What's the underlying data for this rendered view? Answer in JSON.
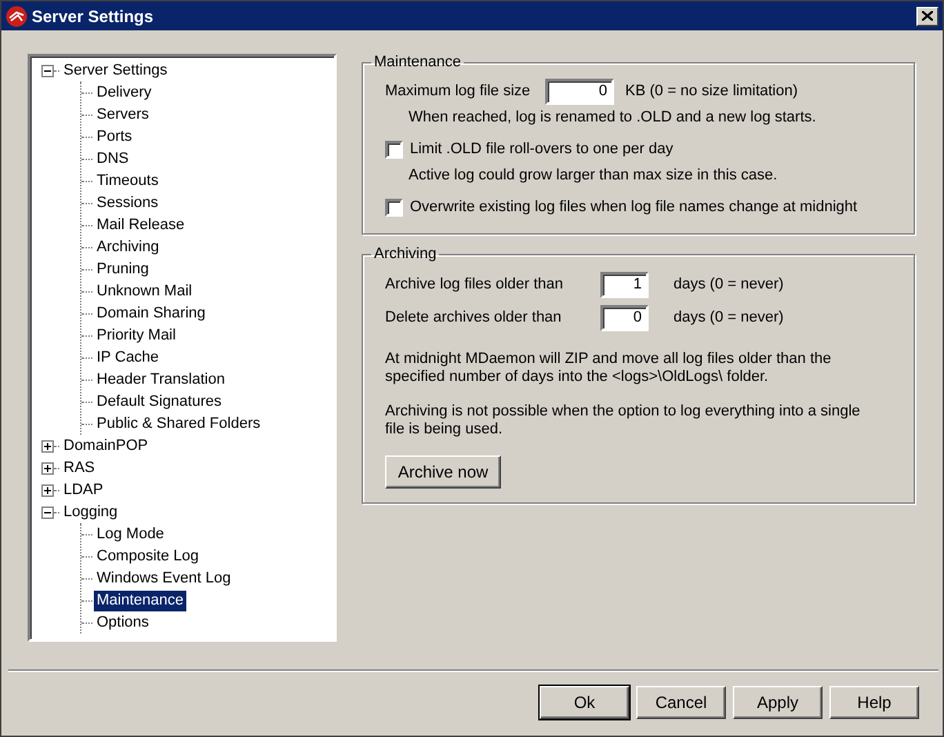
{
  "window": {
    "title": "Server Settings"
  },
  "tree": [
    {
      "label": "Server Settings",
      "expanded": true,
      "selected": false,
      "children": [
        {
          "label": "Delivery",
          "selected": false
        },
        {
          "label": "Servers",
          "selected": false
        },
        {
          "label": "Ports",
          "selected": false
        },
        {
          "label": "DNS",
          "selected": false
        },
        {
          "label": "Timeouts",
          "selected": false
        },
        {
          "label": "Sessions",
          "selected": false
        },
        {
          "label": "Mail Release",
          "selected": false
        },
        {
          "label": "Archiving",
          "selected": false
        },
        {
          "label": "Pruning",
          "selected": false
        },
        {
          "label": "Unknown Mail",
          "selected": false
        },
        {
          "label": "Domain Sharing",
          "selected": false
        },
        {
          "label": "Priority Mail",
          "selected": false
        },
        {
          "label": "IP Cache",
          "selected": false
        },
        {
          "label": "Header Translation",
          "selected": false
        },
        {
          "label": "Default Signatures",
          "selected": false
        },
        {
          "label": "Public & Shared Folders",
          "selected": false
        }
      ]
    },
    {
      "label": "DomainPOP",
      "expanded": false,
      "selected": false
    },
    {
      "label": "RAS",
      "expanded": false,
      "selected": false
    },
    {
      "label": "LDAP",
      "expanded": false,
      "selected": false
    },
    {
      "label": "Logging",
      "expanded": true,
      "selected": false,
      "children": [
        {
          "label": "Log Mode",
          "selected": false
        },
        {
          "label": "Composite Log",
          "selected": false
        },
        {
          "label": "Windows Event Log",
          "selected": false
        },
        {
          "label": "Maintenance",
          "selected": true
        },
        {
          "label": "Options",
          "selected": false
        }
      ]
    }
  ],
  "maintenance": {
    "title": "Maintenance",
    "max_size_label": "Maximum log file size",
    "max_size_value": "0",
    "max_size_unit": "KB (0 = no size limitation)",
    "max_size_note": "When reached, log is renamed to .OLD and a new log starts.",
    "options": [
      {
        "label": "Limit .OLD file roll-overs to one per day",
        "checked": false,
        "note": "Active log could grow larger than max size in this case."
      },
      {
        "label": "Overwrite existing log files when log file names change at midnight",
        "checked": false
      }
    ]
  },
  "archiving": {
    "title": "Archiving",
    "fields": [
      {
        "label": "Archive log files older than",
        "value": "1",
        "unit": "days (0 = never)"
      },
      {
        "label": "Delete archives older than",
        "value": "0",
        "unit": "days (0 = never)"
      }
    ],
    "notes": [
      "At midnight MDaemon will ZIP and move all log files older than the specified number of days into the <logs>\\OldLogs\\ folder.",
      "Archiving is not possible when the option to log everything into a single file is being used."
    ],
    "button": "Archive now"
  },
  "buttons": [
    {
      "label": "Ok",
      "default": true
    },
    {
      "label": "Cancel",
      "default": false
    },
    {
      "label": "Apply",
      "default": false
    },
    {
      "label": "Help",
      "default": false
    }
  ]
}
